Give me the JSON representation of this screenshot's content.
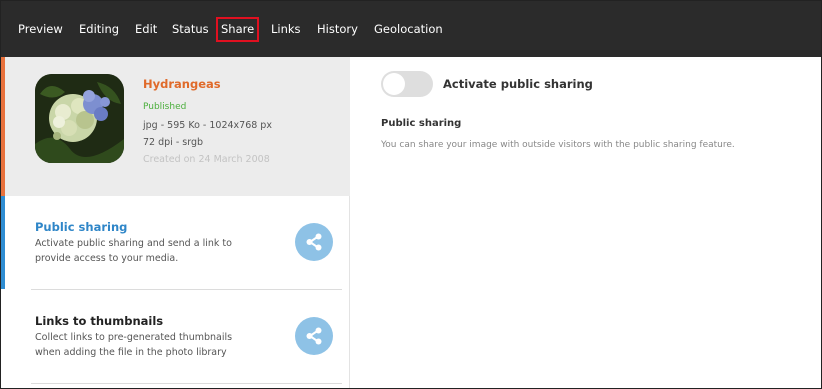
{
  "nav": {
    "tabs": [
      {
        "label": "Preview"
      },
      {
        "label": "Editing"
      },
      {
        "label": "Edit"
      },
      {
        "label": "Status"
      },
      {
        "label": "Share",
        "active": true
      },
      {
        "label": "Links"
      },
      {
        "label": "History"
      },
      {
        "label": "Geolocation"
      }
    ]
  },
  "media": {
    "title": "Hydrangeas",
    "status": "Published",
    "meta_line1": "jpg - 595 Ko - 1024x768 px",
    "meta_line2": "72 dpi - srgb",
    "created": "Created on 24 March 2008",
    "thumbnail_icon": "hydrangea-photo"
  },
  "sections": [
    {
      "title": "Public sharing",
      "desc_line1": "Activate public sharing and send a link to",
      "desc_line2": "provide access to your media.",
      "icon": "share-icon"
    },
    {
      "title": "Links to thumbnails",
      "desc_line1": "Collect links to pre-generated thumbnails",
      "desc_line2": "when adding the file in the photo library",
      "icon": "share-icon"
    }
  ],
  "sharing_panel": {
    "toggle_label": "Activate public sharing",
    "toggle_on": false,
    "heading": "Public sharing",
    "description": "You can share your image with outside visitors with the public sharing feature."
  },
  "colors": {
    "topbar": "#2b2b2b",
    "active_tab_border": "#e01020",
    "media_title": "#e06a2a",
    "published": "#4caf3d",
    "section_accent": "#2f8dd2",
    "share_circle": "#8ec2e6"
  }
}
